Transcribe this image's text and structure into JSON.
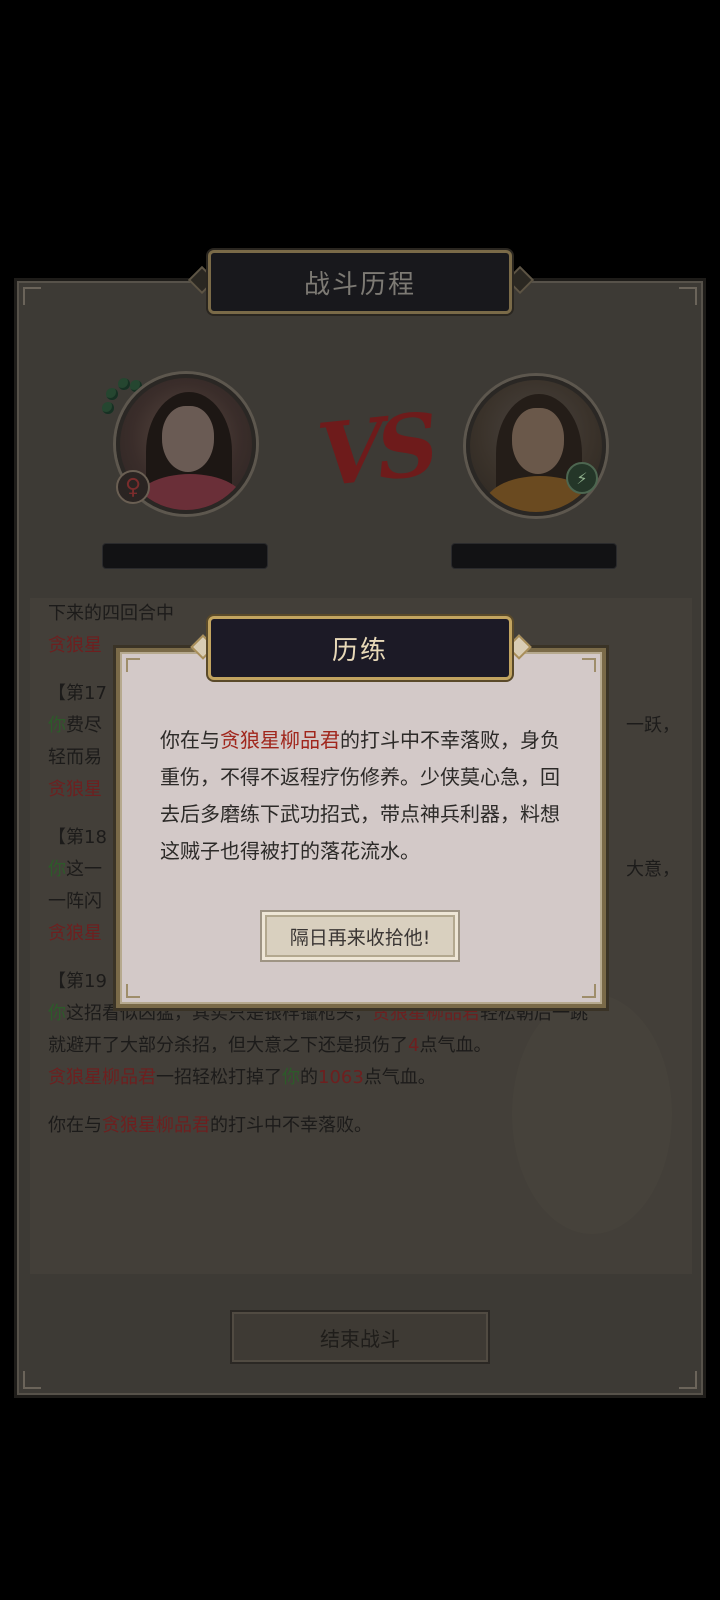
{
  "header": {
    "title": "战斗历程"
  },
  "battle": {
    "left_gender_icon": "♀",
    "right_school_icon": "⚡",
    "vs_text": "VS"
  },
  "log": {
    "lines": [
      {
        "id": "l1",
        "segments": [
          {
            "t": "下来的四回合中",
            "c": "dim"
          }
        ]
      },
      {
        "id": "l2",
        "segments": [
          {
            "t": "贪狼星",
            "c": "red"
          }
        ]
      },
      {
        "id": "l3",
        "segments": [
          {
            "t": "【第17",
            "c": "dim"
          }
        ]
      },
      {
        "id": "l4",
        "segments": [
          {
            "t": "你",
            "c": "green"
          },
          {
            "t": "费尽",
            "c": "dim"
          }
        ]
      },
      {
        "id": "l5",
        "segments": [
          {
            "t": "轻而易",
            "c": "dim"
          }
        ]
      },
      {
        "id": "l6",
        "segments": [
          {
            "t": "贪狼星",
            "c": "red"
          }
        ]
      },
      {
        "id": "l7",
        "segments": [
          {
            "t": "【第18",
            "c": "dim"
          }
        ]
      },
      {
        "id": "l8",
        "segments": [
          {
            "t": "你",
            "c": "green"
          },
          {
            "t": "这一",
            "c": "dim"
          }
        ]
      },
      {
        "id": "l9",
        "segments": [
          {
            "t": "一阵闪",
            "c": "dim"
          }
        ]
      },
      {
        "id": "l10",
        "segments": [
          {
            "t": "贪狼星",
            "c": "red"
          }
        ]
      },
      {
        "id": "l11",
        "segments": [
          {
            "t": "【第19",
            "c": "dim"
          }
        ]
      },
      {
        "id": "l12",
        "segments": [
          {
            "t": "你",
            "c": "green"
          },
          {
            "t": "这招看似凶猛，其实只是银样镴枪头，",
            "c": "dim"
          },
          {
            "t": "贪狼星柳品君",
            "c": "red"
          },
          {
            "t": "轻松朝后一跳",
            "c": "dim"
          }
        ]
      },
      {
        "id": "l13",
        "segments": [
          {
            "t": "就避开了大部分杀招，但大意之下还是损伤了",
            "c": "dim"
          },
          {
            "t": "4",
            "c": "red"
          },
          {
            "t": "点气血。",
            "c": "dim"
          }
        ]
      },
      {
        "id": "l14",
        "segments": [
          {
            "t": "贪狼星柳品君",
            "c": "red"
          },
          {
            "t": "一招轻松打掉了",
            "c": "dim"
          },
          {
            "t": "你",
            "c": "green"
          },
          {
            "t": "的",
            "c": "dim"
          },
          {
            "t": "1063",
            "c": "red"
          },
          {
            "t": "点气血。",
            "c": "dim"
          }
        ]
      },
      {
        "id": "l15",
        "segments": [
          {
            "t": "你在与",
            "c": "dim"
          },
          {
            "t": "贪狼星柳品君",
            "c": "red"
          },
          {
            "t": "的打斗中不幸落败。",
            "c": "dim"
          }
        ]
      }
    ],
    "right_fragments": [
      {
        "text": "一跃，",
        "line": "l4"
      },
      {
        "text": "大意，",
        "line": "l8"
      }
    ]
  },
  "end_button": {
    "label": "结束战斗"
  },
  "modal": {
    "title": "历练",
    "text_before": "你在与",
    "enemy_name": "贪狼星柳品君",
    "text_after": "的打斗中不幸落败，身负重伤，不得不返程疗伤修养。少侠莫心急，回去后多磨练下武功招式，带点神兵利器，料想这贼子也得被打的落花流水。",
    "confirm_label": "隔日再来收拾他!"
  }
}
